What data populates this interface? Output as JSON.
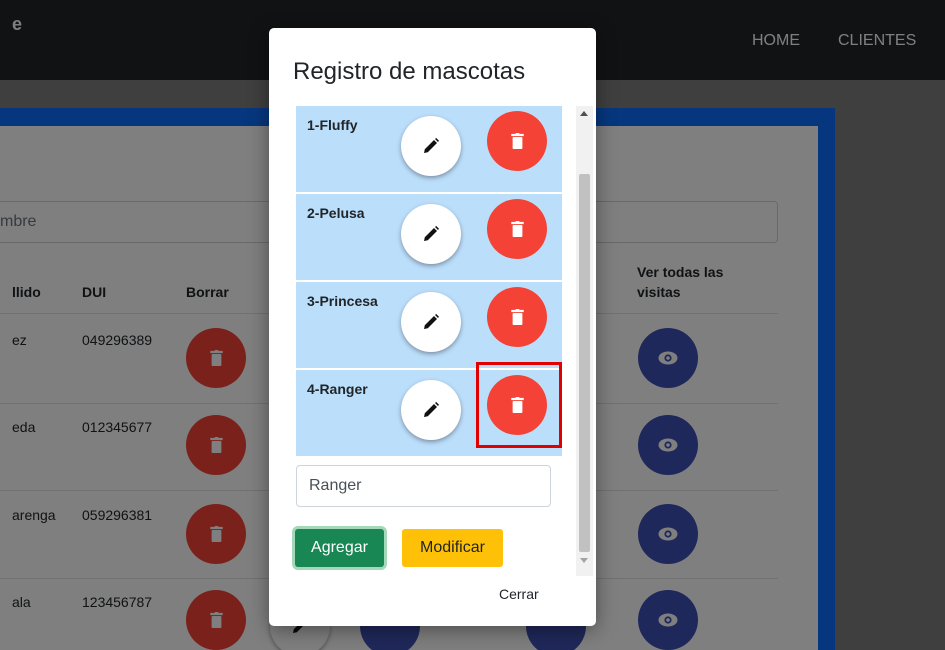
{
  "navbar": {
    "brand": "e",
    "links": [
      "HOME",
      "CLIENTES"
    ]
  },
  "background": {
    "search": {
      "placeholder_fragment": "mbre"
    },
    "table": {
      "headers": {
        "apellido": "llido",
        "dui": "DUI",
        "borrar": "Borrar",
        "ver_visitas": "Ver todas las visitas"
      },
      "rows": [
        {
          "apellido": "ez",
          "dui": "049296389"
        },
        {
          "apellido": "eda",
          "dui": "012345677"
        },
        {
          "apellido": "arenga",
          "dui": "059296381"
        },
        {
          "apellido": "ala",
          "dui": "123456787"
        }
      ]
    }
  },
  "modal": {
    "title": "Registro de mascotas",
    "pets": [
      {
        "label": "1-Fluffy"
      },
      {
        "label": "2-Pelusa"
      },
      {
        "label": "3-Princesa"
      },
      {
        "label": "4-Ranger"
      }
    ],
    "input_value": "Ranger",
    "buttons": {
      "agregar": "Agregar",
      "modificar": "Modificar",
      "cerrar": "Cerrar"
    }
  },
  "colors": {
    "navbar": "#212529",
    "primary": "#0d6efd",
    "delete_red": "#f44336",
    "view_indigo": "#3f51b5",
    "list_item_bg": "#bbdefb",
    "success": "#198754",
    "warning": "#ffc107",
    "highlight": "#e00000"
  },
  "icons": {
    "edit": "pencil-icon",
    "delete": "trash-icon",
    "view": "eye-icon"
  }
}
